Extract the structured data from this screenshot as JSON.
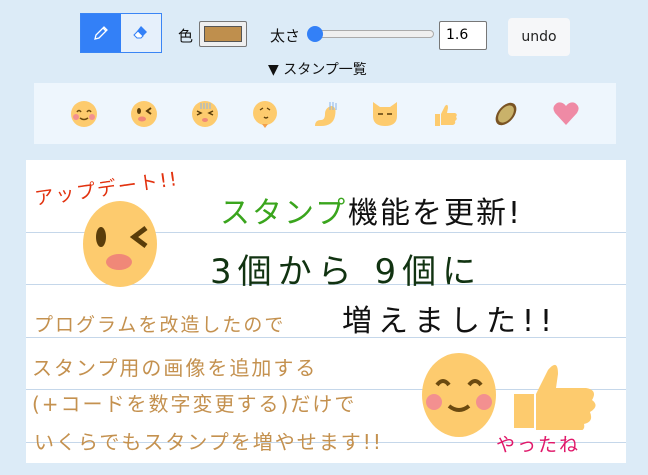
{
  "toolbar": {
    "tools": [
      {
        "name": "pen",
        "icon": "pencil-icon",
        "active": true
      },
      {
        "name": "eraser",
        "icon": "eraser-icon",
        "active": false
      }
    ],
    "color_label": "色",
    "color_value": "#bf8f4d",
    "width_label": "太さ",
    "width_value": "1.6",
    "width_slider_fraction": 0.06,
    "undo_label": "undo"
  },
  "stamp_list": {
    "summary": "▼ スタンプ一覧",
    "stamps": [
      "smile-blush",
      "wink",
      "distress",
      "thinking",
      "stomach",
      "cat",
      "thumbs-up",
      "pizza",
      "heart"
    ]
  },
  "canvas": {
    "texts": {
      "update": "アップデート!!",
      "line1a": "スタンプ",
      "line1b": "機能を更新!",
      "line2": "3個から 9個に",
      "line3": "増えました!!",
      "p1": "プログラムを改造したので",
      "p2": "スタンプ用の画像を追加する",
      "p3": "(+コードを数字変更する)だけで",
      "p4": "いくらでもスタンプを増やせます!!",
      "yatta": "やったね"
    },
    "colors": {
      "red": "#e2320f",
      "green": "#3aa51d",
      "black": "#111111",
      "brown": "#c4914f",
      "pink": "#e0186a"
    }
  }
}
